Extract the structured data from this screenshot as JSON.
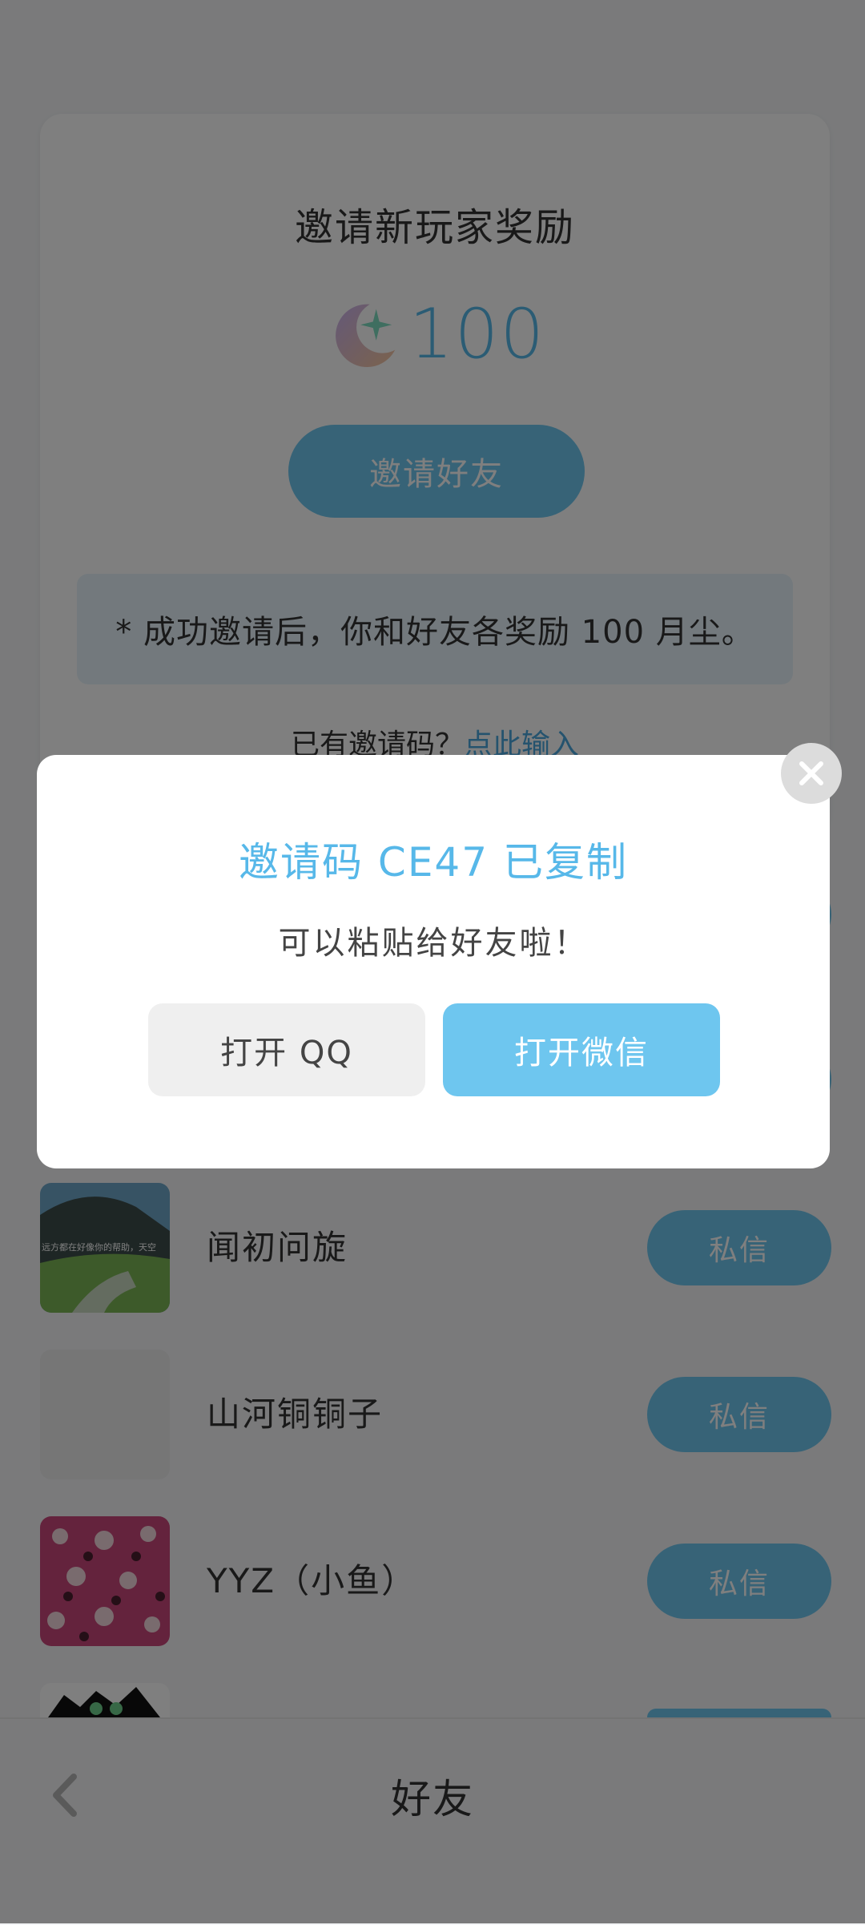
{
  "invite": {
    "title": "邀请新玩家奖励",
    "reward_amount": "100",
    "reward_icon": "moon-dust-icon",
    "invite_button": "邀请好友",
    "note": "* 成功邀请后，你和好友各奖励 100 月尘。",
    "code_prompt": "已有邀请码？",
    "code_link": "点此输入"
  },
  "friends": [
    {
      "name": "闻初问旋",
      "action": "私信",
      "avatar_caption": "远方都在好像你的帮助，天空"
    },
    {
      "name": "山河铜铜子",
      "action": "私信"
    },
    {
      "name": "YYZ（小鱼）",
      "action": "私信"
    }
  ],
  "bottom_nav": {
    "title": "好友",
    "back_icon": "chevron-left-icon"
  },
  "modal": {
    "title": "邀请码 CE47 已复制",
    "subtitle": "可以粘贴给好友啦！",
    "qq_button": "打开 QQ",
    "wechat_button": "打开微信",
    "close_icon": "close-icon"
  },
  "colors": {
    "accent": "#6ec6ef",
    "accent_text": "#57b8e9",
    "note_background": "#e6f3fa",
    "overlay": "rgba(0,0,0,0.5)"
  }
}
